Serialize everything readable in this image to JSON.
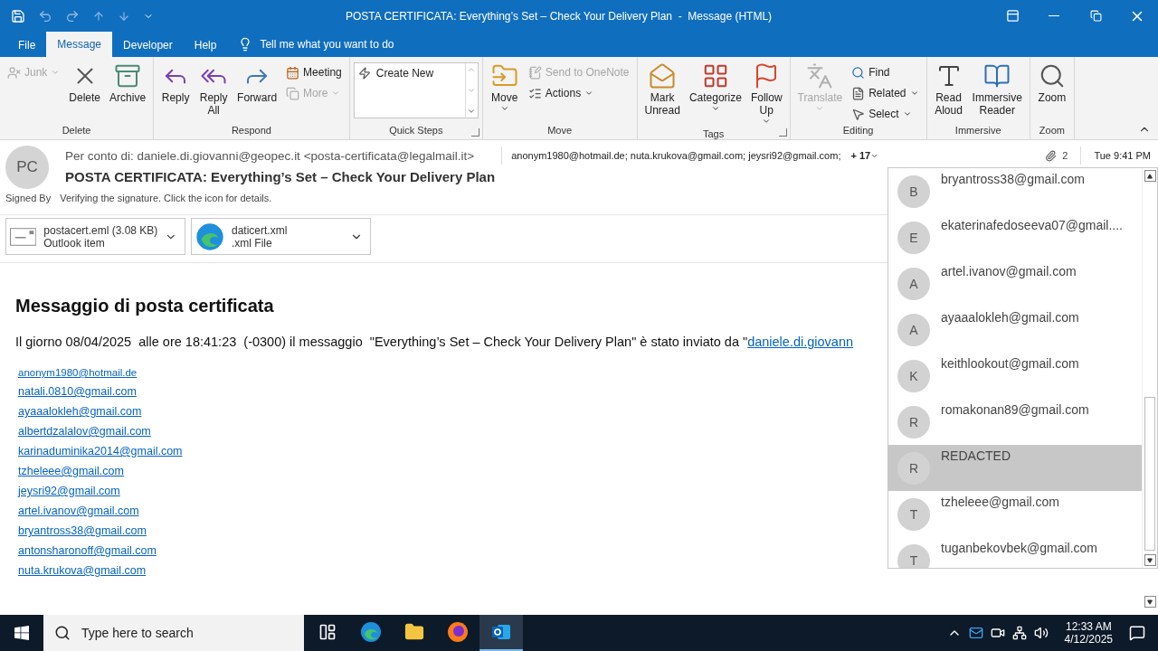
{
  "window": {
    "title": "POSTA CERTIFICATA: Everything’s Set – Check Your Delivery Plan  -  Message (HTML)"
  },
  "tabs": [
    {
      "label": "File",
      "selected": false
    },
    {
      "label": "Message",
      "selected": true
    },
    {
      "label": "Developer",
      "selected": false
    },
    {
      "label": "Help",
      "selected": false
    }
  ],
  "tell_me": {
    "placeholder": "Tell me what you want to do"
  },
  "ribbon": {
    "groups": [
      {
        "label": "Delete",
        "launcher": false,
        "items": [
          {
            "kind": "small",
            "label": "Junk",
            "disabled": true,
            "dropdown": true
          },
          {
            "kind": "large",
            "label": "Delete",
            "disabled": false,
            "dropdown": false
          },
          {
            "kind": "large",
            "label": "Archive",
            "disabled": false,
            "dropdown": false
          }
        ]
      },
      {
        "label": "Respond",
        "launcher": false,
        "items": [
          {
            "kind": "large",
            "label": "Reply",
            "disabled": false,
            "dropdown": false
          },
          {
            "kind": "large",
            "label": "Reply\nAll",
            "disabled": false,
            "dropdown": false
          },
          {
            "kind": "large",
            "label": "Forward",
            "disabled": false,
            "dropdown": false
          },
          {
            "kind": "small",
            "label": "Meeting",
            "disabled": false,
            "dropdown": false
          },
          {
            "kind": "small",
            "label": "More",
            "disabled": true,
            "dropdown": true
          }
        ]
      },
      {
        "label": "Quick Steps",
        "launcher": true,
        "items": [
          {
            "kind": "gallery",
            "label": "Create New",
            "disabled": false,
            "dropdown": false
          }
        ]
      },
      {
        "label": "Move",
        "launcher": false,
        "items": [
          {
            "kind": "large",
            "label": "Move",
            "disabled": false,
            "dropdown": true
          },
          {
            "kind": "small",
            "label": "Send to OneNote",
            "disabled": true,
            "dropdown": false
          },
          {
            "kind": "small",
            "label": "Actions",
            "disabled": false,
            "dropdown": true
          }
        ]
      },
      {
        "label": "Tags",
        "launcher": true,
        "items": [
          {
            "kind": "large",
            "label": "Mark\nUnread",
            "disabled": false,
            "dropdown": false
          },
          {
            "kind": "large",
            "label": "Categorize",
            "disabled": false,
            "dropdown": true
          },
          {
            "kind": "large",
            "label": "Follow\nUp",
            "disabled": false,
            "dropdown": true
          }
        ]
      },
      {
        "label": "Editing",
        "launcher": false,
        "items": [
          {
            "kind": "large",
            "label": "Translate",
            "disabled": true,
            "dropdown": true
          },
          {
            "kind": "small",
            "label": "Find",
            "disabled": false,
            "dropdown": false
          },
          {
            "kind": "small",
            "label": "Related",
            "disabled": false,
            "dropdown": true
          },
          {
            "kind": "small",
            "label": "Select",
            "disabled": false,
            "dropdown": true
          }
        ]
      },
      {
        "label": "Immersive",
        "launcher": false,
        "items": [
          {
            "kind": "large",
            "label": "Read\nAloud",
            "disabled": false,
            "dropdown": false
          },
          {
            "kind": "large",
            "label": "Immersive\nReader",
            "disabled": false,
            "dropdown": false
          }
        ]
      },
      {
        "label": "Zoom",
        "launcher": false,
        "items": [
          {
            "kind": "large",
            "label": "Zoom",
            "disabled": false,
            "dropdown": false
          }
        ]
      }
    ]
  },
  "header": {
    "avatar": "PC",
    "from": "Per conto di: daniele.di.giovanni@geopec.it <posta-certificata@legalmail.it>",
    "recipients": "anonym1980@hotmail.de; nuta.krukova@gmail.com; jeysri92@gmail.com;",
    "more": "+ 17",
    "attachment_count": "2",
    "date": "Tue 9:41 PM",
    "subject": "POSTA CERTIFICATA: Everything’s Set – Check Your Delivery Plan",
    "signed_label": "Signed By",
    "signed_status": "Verifying the signature. Click the icon for details."
  },
  "attachments": [
    {
      "name": "postacert.eml (3.08 KB)",
      "type": "Outlook item"
    },
    {
      "name": "daticert.xml",
      "type": ".xml File"
    }
  ],
  "body": {
    "heading": "Messaggio di posta certificata",
    "paragraph": "Il giorno 08/04/2025  alle ore 18:41:23  (-0300) il messaggio  \"Everything’s Set – Check Your Delivery Plan\" è stato inviato da \"",
    "paragraph_link": "daniele.di.giovann",
    "links": [
      "anonym1980@hotmail.de",
      "natali.0810@gmail.com",
      "ayaaalokleh@gmail.com",
      "albertdzalalov@gmail.com",
      "karinaduminika2014@gmail.com",
      "tzheleee@gmail.com",
      "jeysri92@gmail.com",
      "artel.ivanov@gmail.com",
      "bryantross38@gmail.com",
      "antonsharonoff@gmail.com",
      "nuta.krukova@gmail.com"
    ]
  },
  "recipient_popup": {
    "items": [
      {
        "initial": "B",
        "email": "bryantross38@gmail.com",
        "selected": false
      },
      {
        "initial": "E",
        "email": "ekaterinafedoseeva07@gmail....",
        "selected": false
      },
      {
        "initial": "A",
        "email": "artel.ivanov@gmail.com",
        "selected": false
      },
      {
        "initial": "A",
        "email": "ayaaalokleh@gmail.com",
        "selected": false
      },
      {
        "initial": "K",
        "email": "keithlookout@gmail.com",
        "selected": false
      },
      {
        "initial": "R",
        "email": "romakonan89@gmail.com",
        "selected": false
      },
      {
        "initial": "R",
        "email": "REDACTED",
        "selected": true
      },
      {
        "initial": "T",
        "email": "tzheleee@gmail.com",
        "selected": false
      },
      {
        "initial": "T",
        "email": "tuganbekovbek@gmail.com",
        "selected": false
      }
    ]
  },
  "taskbar": {
    "search": {
      "placeholder": "Type here to search"
    },
    "apps": [
      {
        "selected": false
      },
      {
        "selected": false
      },
      {
        "selected": false
      },
      {
        "selected": false
      },
      {
        "selected": true
      }
    ],
    "time": "12:33 AM",
    "date": "4/12/2025"
  }
}
